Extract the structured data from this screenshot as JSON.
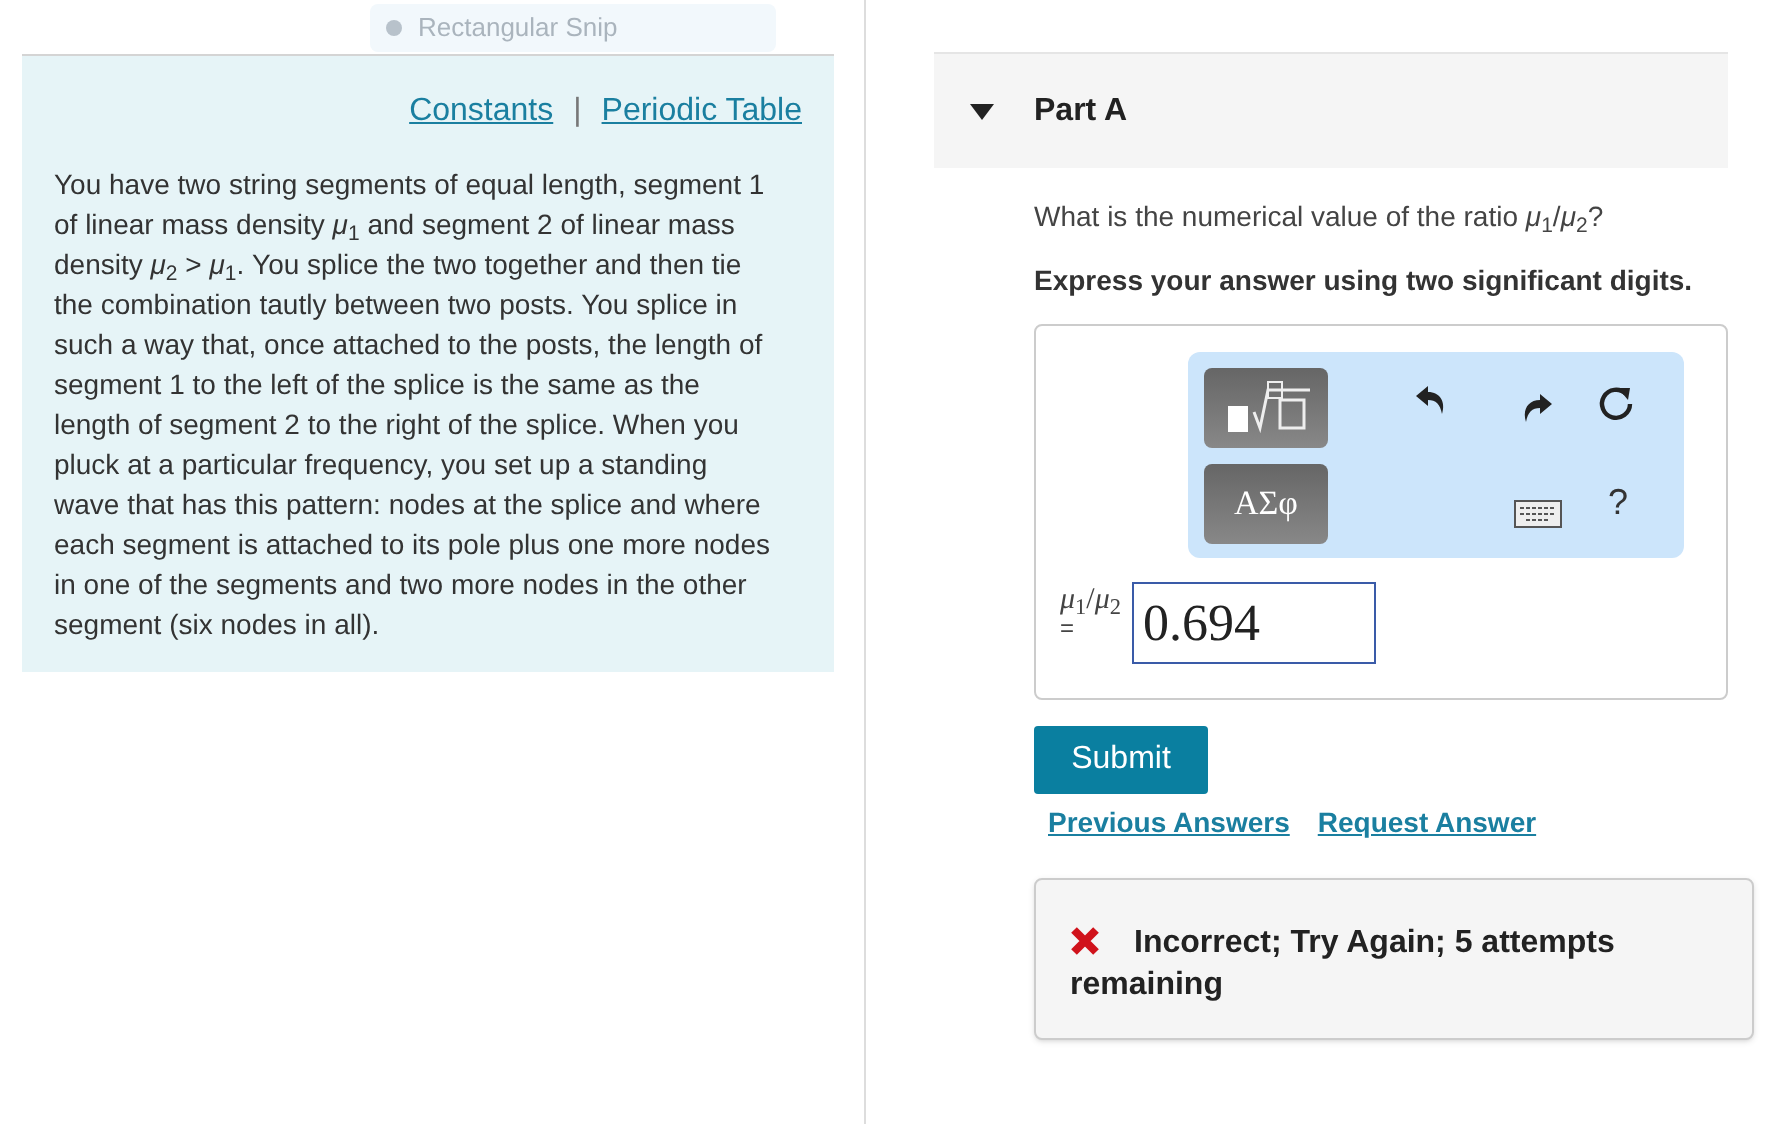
{
  "snip_toolbar": {
    "label": "Rectangular Snip"
  },
  "links": [
    "Constants",
    "Periodic Table"
  ],
  "link_separator": "|",
  "problem_text": "You have two string segments of equal length, segment 1 of linear mass density *μ*$_{1}$ and segment 2 of linear mass density *μ*$_{2}$ > *μ*$_{1}$. You splice the two together and then tie the combination tautly between two posts. You splice in such a way that, once attached to the posts, the length of segment 1 to the left of the splice is the same as the length of segment 2 to the right of the splice. When you pluck at a particular frequency, you set up a standing wave that has this pattern: nodes at the splice and where each segment is attached to its pole plus one more nodes in one of the segments and two more nodes in the other segment (six nodes in all).",
  "part": {
    "title": "Part A",
    "expanded": true
  },
  "question": "What is the numerical value of the ratio *μ*$_{1}$/*μ*$_{2}$?",
  "instruction": "Express your answer using two significant digits.",
  "toolbar": {
    "symbols_button": "ΑΣφ",
    "help_button": "?"
  },
  "answer": {
    "label": "*μ*$_{1}$/*μ*$_{2}$",
    "equals": "=",
    "value": "0.694"
  },
  "submit": "Submit",
  "secondary_links": [
    "Previous Answers",
    "Request Answer"
  ],
  "feedback": {
    "correct": false,
    "message": "Incorrect; Try Again; 5 attempts remaining"
  }
}
